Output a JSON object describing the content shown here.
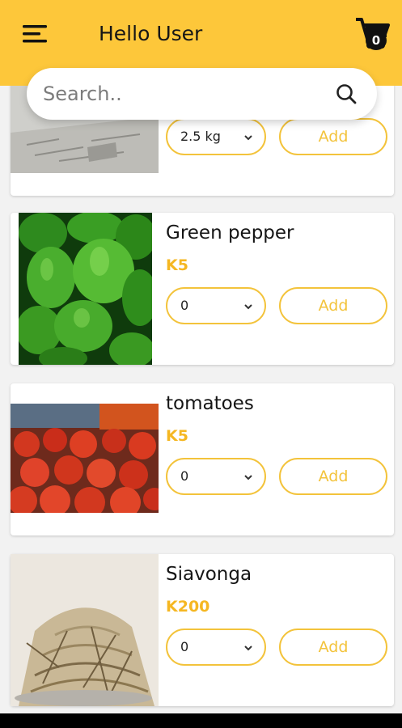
{
  "header": {
    "title": "Hello User",
    "cart_count": "0",
    "accent": "#fdc73a"
  },
  "search": {
    "placeholder": "Search.."
  },
  "products": [
    {
      "name": "",
      "price": "",
      "qty": "2.5 kg",
      "add_label": "Add"
    },
    {
      "name": "Green pepper",
      "price": "K5",
      "qty": "0",
      "add_label": "Add"
    },
    {
      "name": "tomatoes",
      "price": "K5",
      "qty": "0",
      "add_label": "Add"
    },
    {
      "name": "Siavonga",
      "price": "K200",
      "qty": "0",
      "add_label": "Add"
    }
  ],
  "colors": {
    "price": "#f5b722",
    "outline": "#f3c33b"
  }
}
